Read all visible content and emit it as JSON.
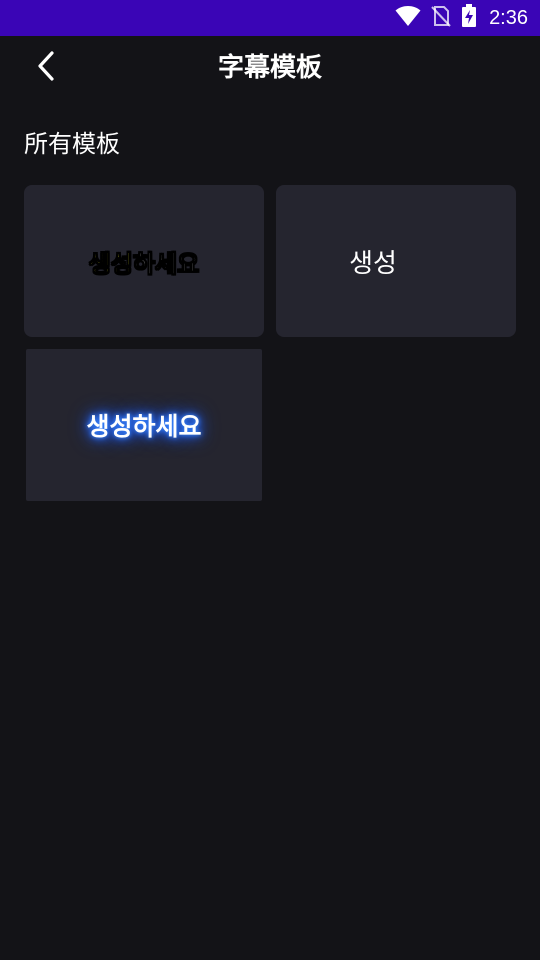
{
  "status_bar": {
    "time": "2:36",
    "background": "#3a05b6",
    "icons": [
      "wifi-icon",
      "no-sim-icon",
      "battery-charging-icon"
    ]
  },
  "app_bar": {
    "title": "字幕模板",
    "back_icon": "chevron-left-icon"
  },
  "section": {
    "title": "所有模板"
  },
  "templates": [
    {
      "highlight": "생성",
      "rest": "하세요",
      "highlight_color": "#ffff33",
      "style": "outlined-bold"
    },
    {
      "text": "생성",
      "style": "serif-plain"
    },
    {
      "text": "생성하세요",
      "glow_color": "#2a6fff",
      "style": "blue-glow"
    }
  ],
  "colors": {
    "background": "#131317",
    "card": "#25252f"
  }
}
